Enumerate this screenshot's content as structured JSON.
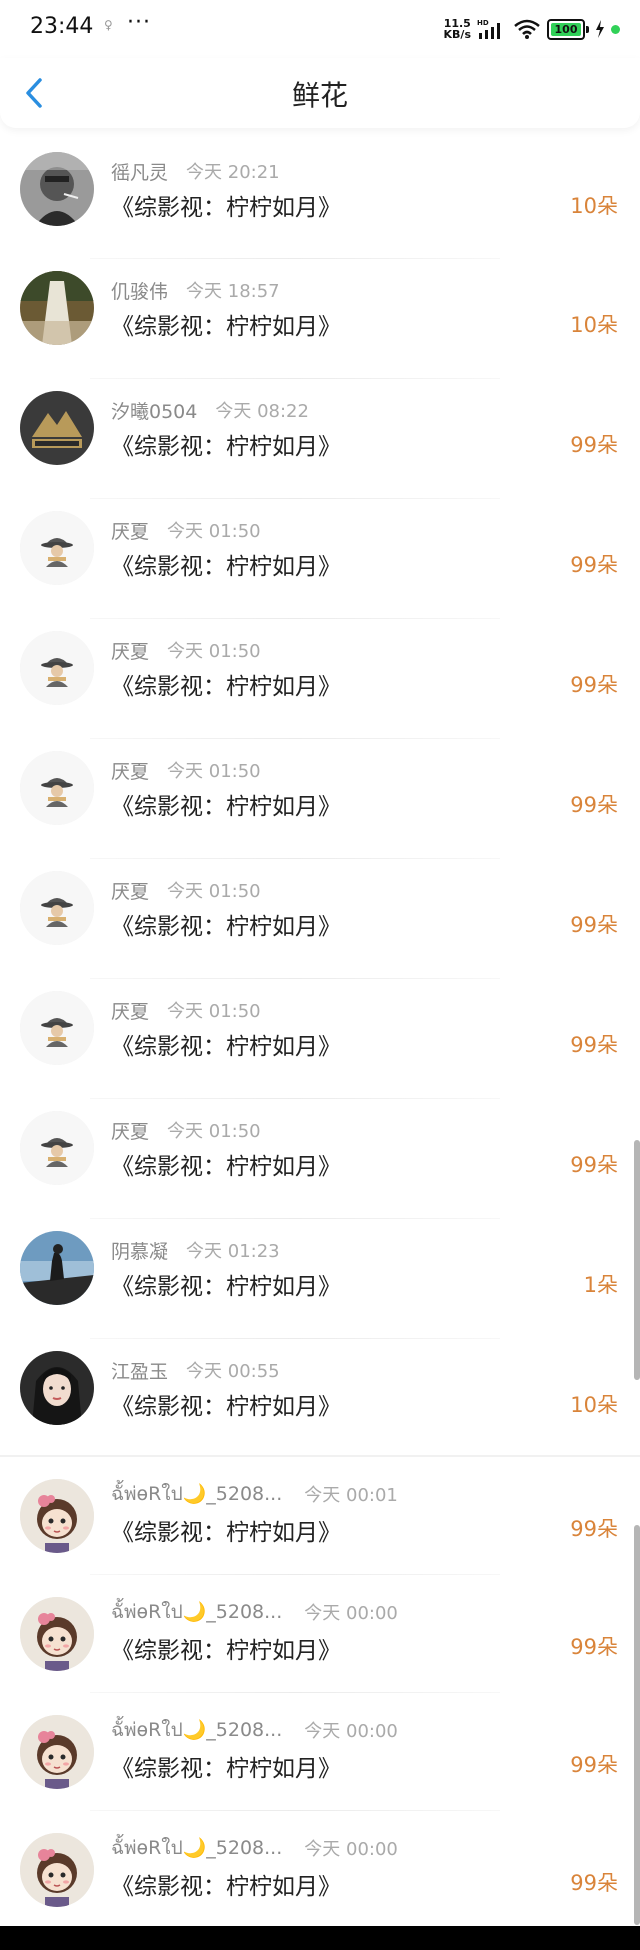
{
  "status_bar": {
    "time": "23:44",
    "speed_value": "11.5",
    "speed_unit": "KB/s",
    "network": "HD",
    "battery": "100"
  },
  "header": {
    "title": "鲜花"
  },
  "items": [
    {
      "name": "徭凡灵",
      "time": "今天 20:21",
      "book": "《综影视：柠柠如月》",
      "count": "10朵",
      "avatar": "man-smoking"
    },
    {
      "name": "仉骏伟",
      "time": "今天 18:57",
      "book": "《综影视：柠柠如月》",
      "count": "10朵",
      "avatar": "waterfall"
    },
    {
      "name": "汐曦0504",
      "time": "今天 08:22",
      "book": "《综影视：柠柠如月》",
      "count": "99朵",
      "avatar": "gold-logo"
    },
    {
      "name": "厌夏",
      "time": "今天 01:50",
      "book": "《综影视：柠柠如月》",
      "count": "99朵",
      "avatar": "ink-figure"
    },
    {
      "name": "厌夏",
      "time": "今天 01:50",
      "book": "《综影视：柠柠如月》",
      "count": "99朵",
      "avatar": "ink-figure"
    },
    {
      "name": "厌夏",
      "time": "今天 01:50",
      "book": "《综影视：柠柠如月》",
      "count": "99朵",
      "avatar": "ink-figure"
    },
    {
      "name": "厌夏",
      "time": "今天 01:50",
      "book": "《综影视：柠柠如月》",
      "count": "99朵",
      "avatar": "ink-figure"
    },
    {
      "name": "厌夏",
      "time": "今天 01:50",
      "book": "《综影视：柠柠如月》",
      "count": "99朵",
      "avatar": "ink-figure"
    },
    {
      "name": "厌夏",
      "time": "今天 01:50",
      "book": "《综影视：柠柠如月》",
      "count": "99朵",
      "avatar": "ink-figure"
    },
    {
      "name": "阴慕凝",
      "time": "今天 01:23",
      "book": "《综影视：柠柠如月》",
      "count": "1朵",
      "avatar": "seaside"
    },
    {
      "name": "江盈玉",
      "time": "今天 00:55",
      "book": "《综影视：柠柠如月》",
      "count": "10朵",
      "avatar": "girl-portrait"
    },
    {
      "name": "ฉั้พ่ѳRใป🌙_5208...",
      "time": "今天 00:01",
      "book": "《综影视：柠柠如月》",
      "count": "99朵",
      "avatar": "cartoon-girl"
    },
    {
      "name": "ฉั้พ่ѳRใป🌙_5208...",
      "time": "今天 00:00",
      "book": "《综影视：柠柠如月》",
      "count": "99朵",
      "avatar": "cartoon-girl"
    },
    {
      "name": "ฉั้พ่ѳRใป🌙_5208...",
      "time": "今天 00:00",
      "book": "《综影视：柠柠如月》",
      "count": "99朵",
      "avatar": "cartoon-girl"
    },
    {
      "name": "ฉั้พ่ѳRใป🌙_5208...",
      "time": "今天 00:00",
      "book": "《综影视：柠柠如月》",
      "count": "99朵",
      "avatar": "cartoon-girl"
    }
  ],
  "colors": {
    "accent": "#2a8ee0",
    "count": "#d9843a",
    "battery": "#31d158"
  }
}
